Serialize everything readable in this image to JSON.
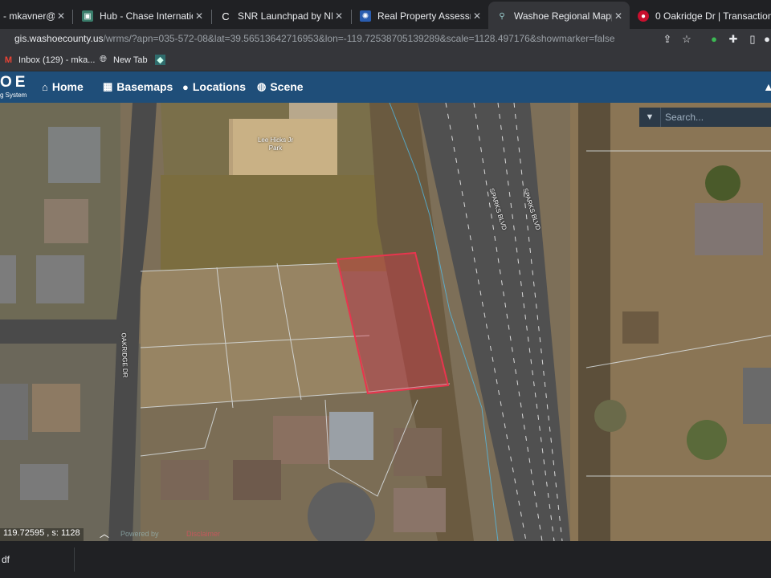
{
  "browser": {
    "tabs": [
      {
        "title": "- mkavner@c",
        "favicon": "gmail-icon"
      },
      {
        "title": "Hub - Chase International",
        "favicon": "hub-icon"
      },
      {
        "title": "SNR Launchpad by NNRML",
        "favicon": "launchpad-icon"
      },
      {
        "title": "Real Property Assessment",
        "favicon": "assessor-icon"
      },
      {
        "title": "Washoe Regional Mapping",
        "favicon": "washoe-map-icon"
      },
      {
        "title": "0 Oakridge Dr | Transaction",
        "favicon": "transaction-icon"
      }
    ],
    "active_tab": 4,
    "url_domain": "gis.washoecounty.us",
    "url_rest": "/wrms/?apn=035-572-08&lat=39.56513642716953&lon=-119.72538705139289&scale=1128.497176&showmarker=false",
    "bookmarks": [
      {
        "label": "Inbox (129) - mka...",
        "icon": "gmail-icon"
      },
      {
        "label": "New Tab",
        "icon": "globe-icon"
      },
      {
        "label": "",
        "icon": "washoe-icon"
      }
    ]
  },
  "app": {
    "logo": "OE",
    "logo_sub": "g System",
    "nav": [
      {
        "label": "Home",
        "icon": "home-icon"
      },
      {
        "label": "Basemaps",
        "icon": "grid-icon"
      },
      {
        "label": "Locations",
        "icon": "pin-icon"
      },
      {
        "label": "Scene",
        "icon": "globe-icon"
      }
    ],
    "search": {
      "placeholder": "Search..."
    }
  },
  "map": {
    "labels": {
      "park": "Lee Hicks Jr Park",
      "road_left": "OAKRIDGE DR",
      "road_right_1": "SPARKS BLVD",
      "road_right_2": "SPARKS BLVD"
    },
    "coords": "119.72595 , s: 1128",
    "powered": "Powered by",
    "disclaimer": "Disclaimer"
  },
  "downloads": [
    {
      "name": "df"
    }
  ],
  "colors": {
    "header": "#1f4e79",
    "parcel": "#e8354e"
  }
}
